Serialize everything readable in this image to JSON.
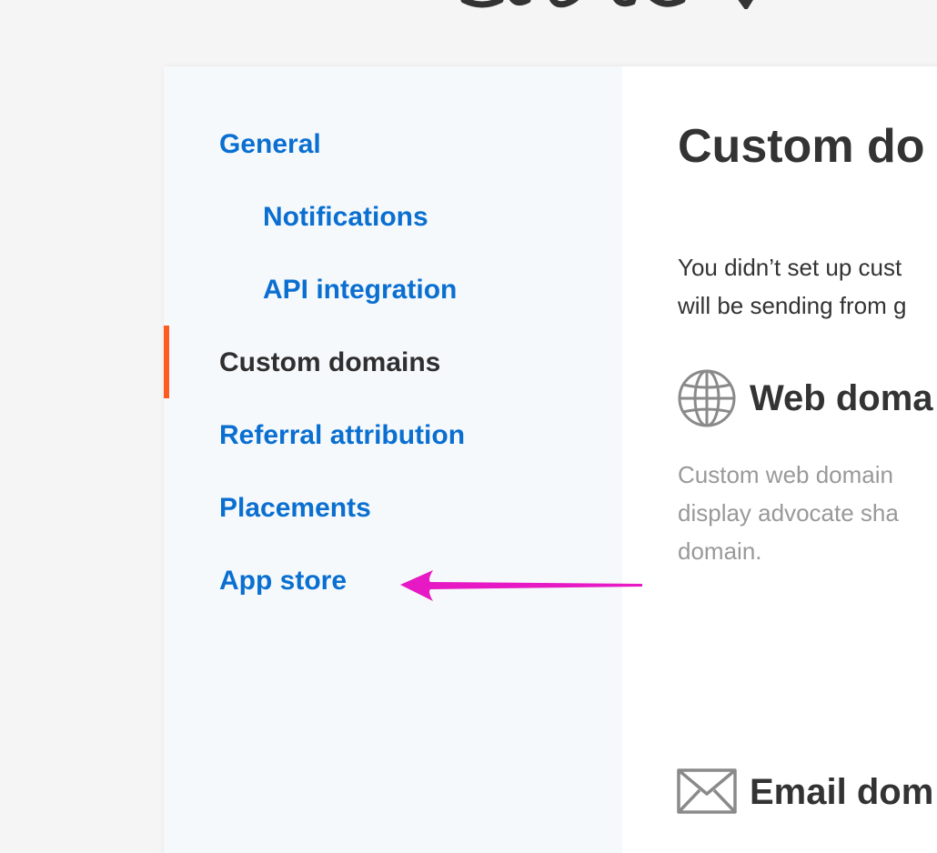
{
  "sidebar": {
    "items": [
      {
        "label": "General",
        "sub": false,
        "active": false
      },
      {
        "label": "Notifications",
        "sub": true,
        "active": false
      },
      {
        "label": "API integration",
        "sub": true,
        "active": false
      },
      {
        "label": "Custom domains",
        "sub": false,
        "active": true
      },
      {
        "label": "Referral attribution",
        "sub": false,
        "active": false
      },
      {
        "label": "Placements",
        "sub": false,
        "active": false
      },
      {
        "label": "App store",
        "sub": false,
        "active": false
      }
    ]
  },
  "main": {
    "title": "Custom do",
    "intro": "You didn’t set up cust\nwill be sending from g",
    "web_section": {
      "icon": "globe-icon",
      "title": "Web doma",
      "description": "Custom web domain\ndisplay advocate sha\ndomain."
    },
    "email_section": {
      "icon": "envelope-icon",
      "title": "Email dom"
    }
  },
  "colors": {
    "link": "#0a6fd0",
    "active_text": "#2f2f2f",
    "active_marker": "#ff5a1f",
    "annotation_arrow": "#e619c4",
    "muted_text": "#999999"
  }
}
